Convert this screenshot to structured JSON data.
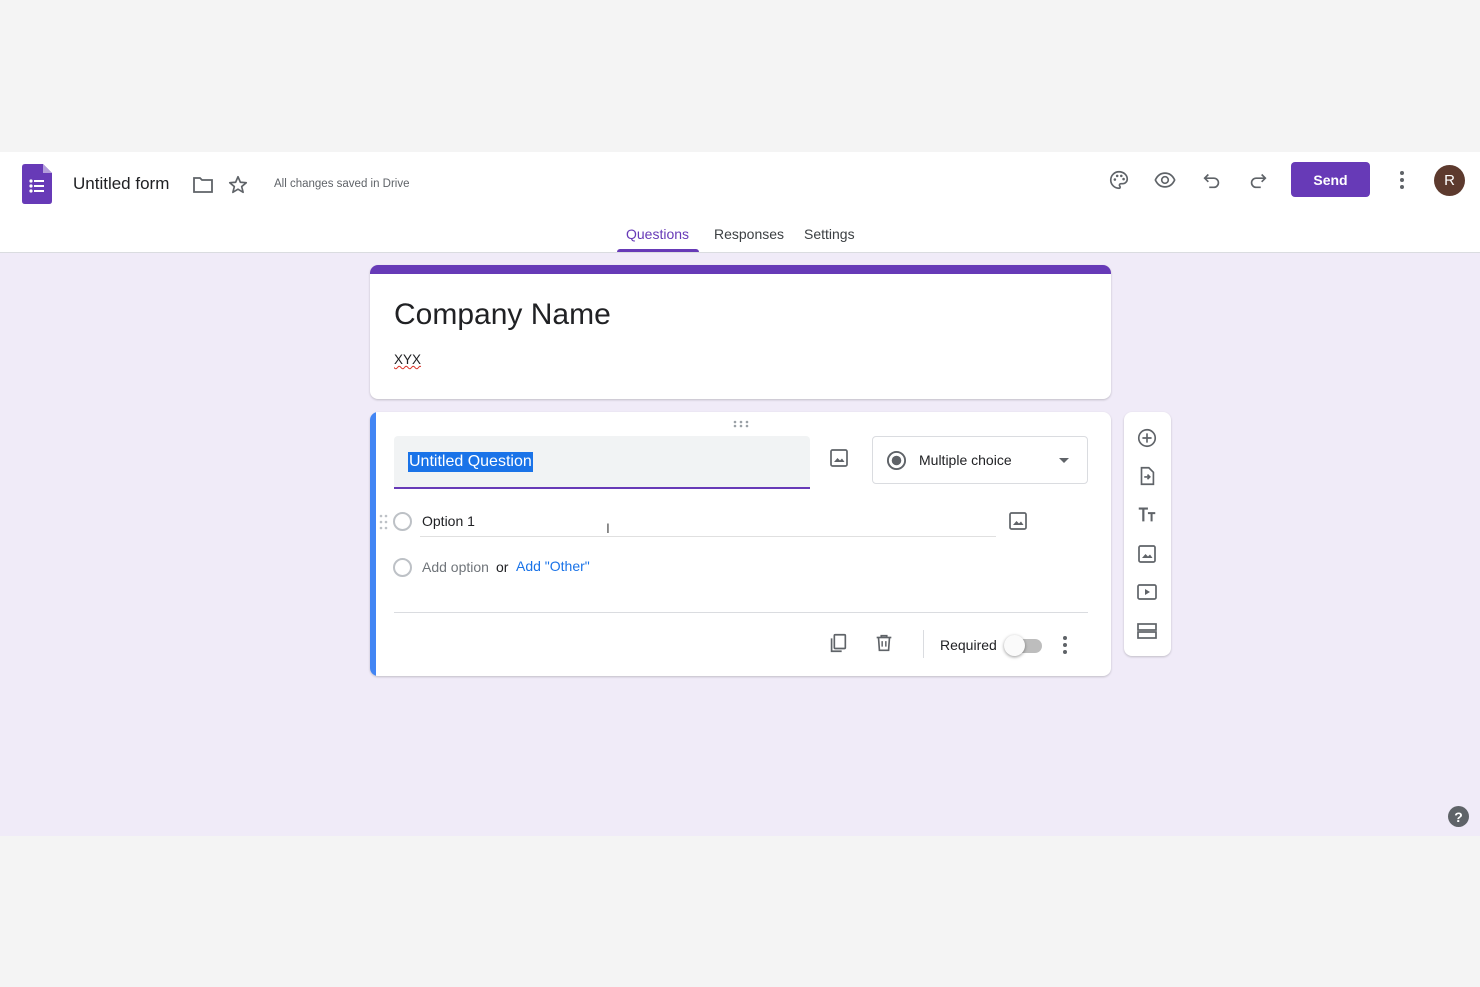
{
  "header": {
    "form_title": "Untitled form",
    "saved_status": "All changes saved in Drive",
    "send_label": "Send",
    "avatar_initial": "R",
    "brand_color": "#673ab7"
  },
  "tabs": [
    {
      "label": "Questions",
      "active": true
    },
    {
      "label": "Responses",
      "active": false
    },
    {
      "label": "Settings",
      "active": false
    }
  ],
  "title_card": {
    "title": "Company Name",
    "description": "XYX"
  },
  "question": {
    "title": "Untitled Question",
    "type": "Multiple choice",
    "options": [
      "Option 1"
    ],
    "add_option": "Add option",
    "or_text": "or",
    "add_other": "Add \"Other\"",
    "required_label": "Required",
    "required": false
  },
  "side_toolbar": [
    "add-question-icon",
    "import-questions-icon",
    "add-title-icon",
    "add-image-icon",
    "add-video-icon",
    "add-section-icon"
  ],
  "help_label": "?"
}
